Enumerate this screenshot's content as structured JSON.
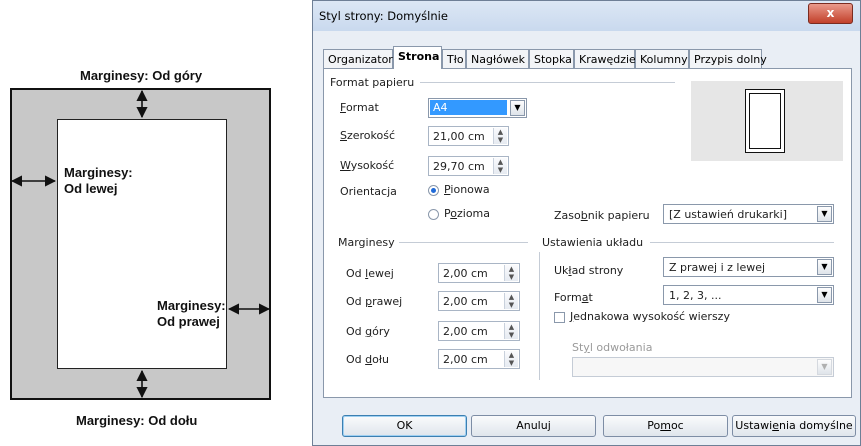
{
  "illustration": {
    "top": "Marginesy: Od góry",
    "left_line1": "Marginesy:",
    "left_line2": "Od lewej",
    "right_line1": "Marginesy:",
    "right_line2": "Od prawej",
    "bottom": "Marginesy: Od dołu"
  },
  "dialog": {
    "title": "Styl strony: Domyślnie",
    "close": "x",
    "tabs": [
      "Organizator",
      "Strona",
      "Tło",
      "Nagłówek",
      "Stopka",
      "Krawędzie",
      "Kolumny",
      "Przypis dolny"
    ],
    "active_tab": "Strona"
  },
  "paper": {
    "section": "Format papieru",
    "format_label": "Format",
    "format_value": "A4",
    "width_label": "Szerokość",
    "width_value": "21,00 cm",
    "height_label": "Wysokość",
    "height_value": "29,70 cm",
    "orientation_label": "Orientacja",
    "portrait": "Pionowa",
    "landscape": "Pozioma",
    "orientation_selected": "Pionowa",
    "tray_label": "Zasobnik papieru",
    "tray_value": "[Z ustawień drukarki]"
  },
  "margins": {
    "section": "Marginesy",
    "left_label": "Od lewej",
    "left_value": "2,00 cm",
    "right_label": "Od prawej",
    "right_value": "2,00 cm",
    "top_label": "Od góry",
    "top_value": "2,00 cm",
    "bottom_label": "Od dołu",
    "bottom_value": "2,00 cm"
  },
  "layout": {
    "section": "Ustawienia układu",
    "page_layout_label": "Układ strony",
    "page_layout_value": "Z prawej i z lewej",
    "format_label": "Format",
    "format_value": "1, 2, 3, ...",
    "register_label": "Jednakowa wysokość wierszy",
    "register_checked": false,
    "ref_style_label": "Styl odwołania",
    "ref_style_value": ""
  },
  "buttons": {
    "ok": "OK",
    "cancel": "Anuluj",
    "help": "Pomoc",
    "reset": "Ustawienia domyślne"
  }
}
